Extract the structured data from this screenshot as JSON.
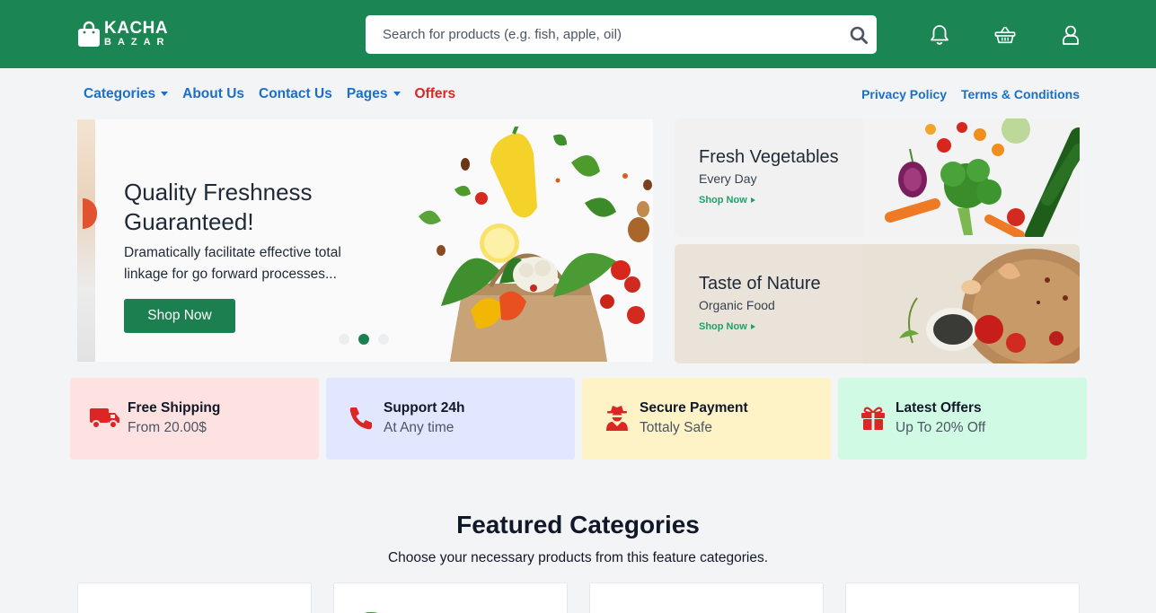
{
  "brand": {
    "line1": "KACHA",
    "line2": "BAZAR",
    "primary_color": "#1b8553"
  },
  "search": {
    "placeholder": "Search for products (e.g. fish, apple, oil)",
    "value": ""
  },
  "header_icons": [
    "bell-icon",
    "shopping-basket-icon",
    "user-icon"
  ],
  "nav": {
    "left": [
      {
        "label": "Categories",
        "dropdown": true
      },
      {
        "label": "About Us",
        "dropdown": false
      },
      {
        "label": "Contact Us",
        "dropdown": false
      },
      {
        "label": "Pages",
        "dropdown": true
      },
      {
        "label": "Offers",
        "dropdown": false
      }
    ],
    "right": [
      {
        "label": "Privacy Policy"
      },
      {
        "label": "Terms & Conditions"
      }
    ]
  },
  "hero": {
    "title": "Quality Freshness Guaranteed!",
    "description": "Dramatically facilitate effective total linkage for go forward processes...",
    "button": "Shop Now",
    "slides": 3,
    "active_slide": 2
  },
  "promos": [
    {
      "title": "Fresh Vegetables",
      "subtitle": "Every Day",
      "link": "Shop Now"
    },
    {
      "title": "Taste of Nature",
      "subtitle": "Organic Food",
      "link": "Shop Now"
    }
  ],
  "features": [
    {
      "title": "Free Shipping",
      "subtitle": "From 20.00$",
      "icon": "truck-icon",
      "bg": "#fee2e2",
      "icon_color": "#dc2626"
    },
    {
      "title": "Support 24h",
      "subtitle": "At Any time",
      "icon": "phone-icon",
      "bg": "#e0e7ff",
      "icon_color": "#dc2626"
    },
    {
      "title": "Secure Payment",
      "subtitle": "Tottaly Safe",
      "icon": "user-secret-icon",
      "bg": "#fef3c7",
      "icon_color": "#dc2626"
    },
    {
      "title": "Latest Offers",
      "subtitle": "Up To 20% Off",
      "icon": "gift-icon",
      "bg": "#d1fae5",
      "icon_color": "#dc2626"
    }
  ],
  "featured": {
    "title": "Featured Categories",
    "subtitle": "Choose your necessary products from this feature categories."
  }
}
